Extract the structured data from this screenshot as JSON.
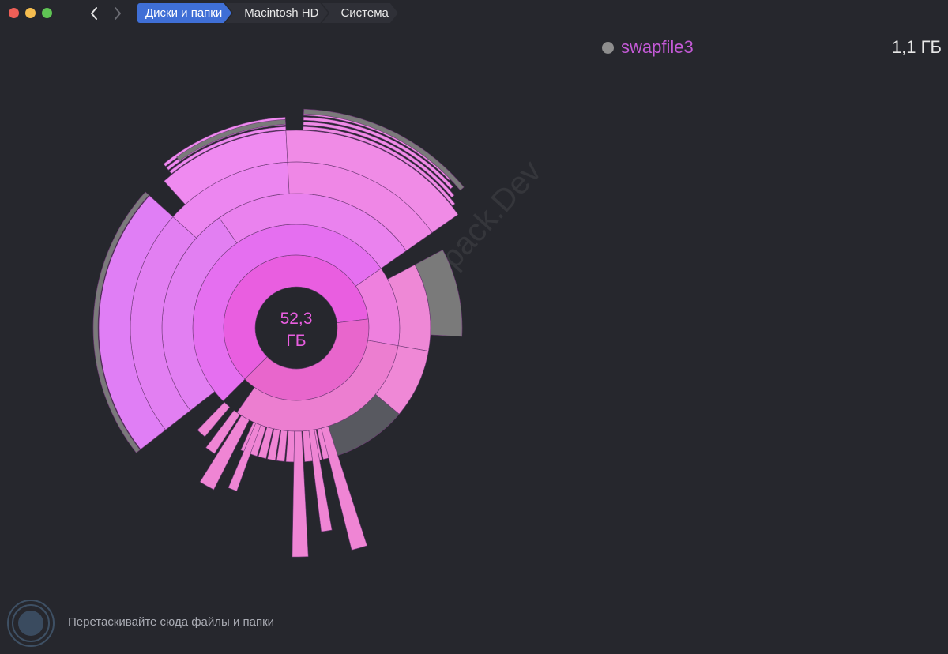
{
  "window": {
    "controls": [
      "close",
      "minimize",
      "zoom"
    ],
    "nav": {
      "back_icon": "chevron-left-icon",
      "forward_icon": "chevron-right-icon"
    }
  },
  "breadcrumb": {
    "items": [
      "Диски и папки",
      "Macintosh HD",
      "Система"
    ]
  },
  "selected": {
    "name": "swapfile3",
    "size": "1,1 ГБ",
    "name_color": "#c55ad8",
    "dot_color": "#8e8e8e"
  },
  "chart": {
    "center_value": "52,3",
    "center_unit": "ГБ"
  },
  "footer": {
    "drop_hint": "Перетаскивайте сюда файлы и папки"
  },
  "watermark": "Driverpack.Dev",
  "colors": {
    "background": "#26272d",
    "accent": "#3f6fd6",
    "sunburst_core": "#e95ee0",
    "sunburst_violet": "#e27ff2",
    "sunburst_pink": "#ef85d9",
    "other_gray": "#7a7a7a"
  }
}
